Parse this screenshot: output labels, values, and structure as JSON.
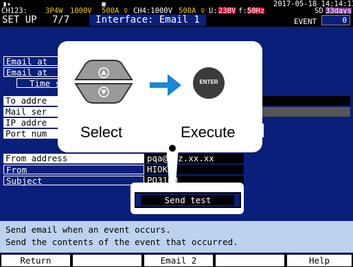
{
  "header": {
    "date_time": "2017-05-18 14:14:11",
    "channel_1": "CH123:",
    "wiring": "3P4W",
    "range_1": "1000V",
    "clamp_1": "500A",
    "channel_2": "CH4:1000V",
    "clamp_2": "500A",
    "u_label": "U:",
    "u_range": "230V",
    "f_label": "f:",
    "f_range": "50Hz",
    "sd_label": "SD",
    "sd_days": "33days",
    "event_label": "EVENT",
    "event_count": "0"
  },
  "titlebar": {
    "menu": "SET UP",
    "page": "7/7",
    "title": "Interface: Email 1"
  },
  "settings": {
    "email_at_1": "Email at",
    "email_at_2": "Email at",
    "time_s": "Time s",
    "to_address": "To addre",
    "mail_server": "Mail ser",
    "ip_address": "IP addre",
    "port_number": "Port num",
    "from_address_label": "From address",
    "from_address_value": "pqa@xyz.xx.xx",
    "from_label": "From",
    "from_value": "HIOKI",
    "subject_label": "Subject",
    "subject_value": "PQ3100"
  },
  "popup": {
    "select_label": "Select",
    "execute_label": "Execute",
    "enter_key": "ENTER"
  },
  "send_test": {
    "label": "Send test"
  },
  "message": {
    "line_1": "Send email when an event occurs.",
    "line_2": "Send the contents of the event that occurred."
  },
  "function_keys": [
    "Return",
    "",
    "Email 2",
    "",
    "Help"
  ],
  "colors": {
    "background": "#0a1f7a",
    "arrow": "#1a86d6",
    "alert_red": "#e0002a",
    "message_bg": "#bcd2ee"
  }
}
